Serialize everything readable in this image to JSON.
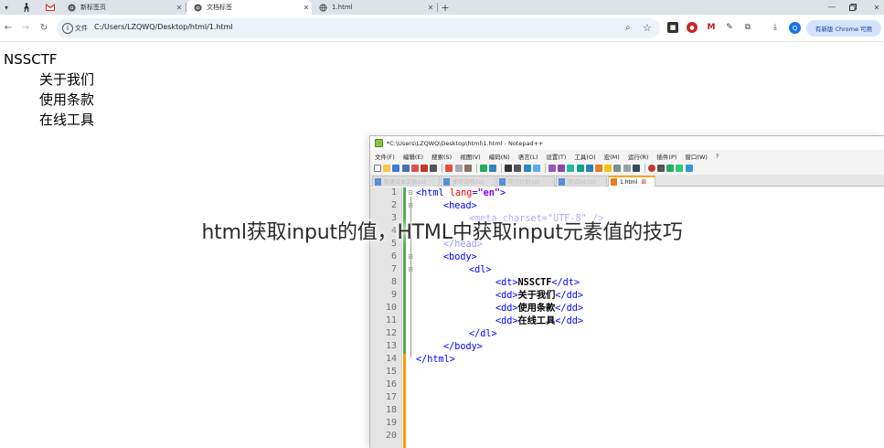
{
  "browser": {
    "tabs": [
      {
        "label": "新标签页",
        "active": false
      },
      {
        "label": "文档标签",
        "active": true
      },
      {
        "label": "1.html",
        "active": false
      }
    ],
    "new_tab_symbol": "+",
    "address": {
      "chip": "文件",
      "url": "C:/Users/LZQWQ/Desktop/html/1.html"
    },
    "update_button": "有新版 Chrome 可用",
    "profile_initial": "Q"
  },
  "page": {
    "dt": "NSSCTF",
    "dd": [
      "关于我们",
      "使用条款",
      "在线工具"
    ]
  },
  "notepad": {
    "title": "*C:\\Users\\LZQWQ\\Desktop\\html\\1.html - Notepad++",
    "menu": [
      "文件(F)",
      "编辑(E)",
      "搜索(S)",
      "视图(V)",
      "编码(N)",
      "语言(L)",
      "设置(T)",
      "工具(O)",
      "宏(M)",
      "运行(R)",
      "插件(P)",
      "窗口(W)",
      "?"
    ],
    "tabs": [
      "新建文本文档.txt",
      "使用说明.txt",
      "学习计划.txt",
      "测试txt.txt",
      "1.html"
    ],
    "active_tab": "1.html",
    "line_numbers": [
      "1",
      "2",
      "3",
      "4",
      "5",
      "6",
      "7",
      "8",
      "9",
      "10",
      "11",
      "12",
      "13",
      "14",
      "15",
      "16",
      "17",
      "18",
      "19",
      "20"
    ],
    "code": {
      "l1": {
        "tag_open": "<html ",
        "attr": "lang",
        "eq": "=",
        "val": "\"en\"",
        "tag_close": ">"
      },
      "l2": "<head>",
      "l3_a": "<meta charset=\"UTF-8\" />",
      "l5": "</head>",
      "l6": "<body>",
      "l7": "<dl>",
      "l8": {
        "open": "<dt>",
        "text": "NSSCTF",
        "close": "</dt>"
      },
      "l9": {
        "open": "<dd>",
        "text": "关于我们",
        "close": "</dd>"
      },
      "l10": {
        "open": "<dd>",
        "text": "使用条款",
        "close": "</dd>"
      },
      "l11": {
        "open": "<dd>",
        "text": "在线工具",
        "close": "</dd>"
      },
      "l12": "</dl>",
      "l13": "</body>",
      "l14": "</html>"
    }
  },
  "caption": "html获取input的值，HTML中获取input元素值的技巧",
  "colors": {
    "tag": "#0000ff",
    "attr": "#ff0000",
    "attr_value": "#8000ff",
    "change_green": "#4caf50",
    "change_orange": "#ff9800"
  }
}
